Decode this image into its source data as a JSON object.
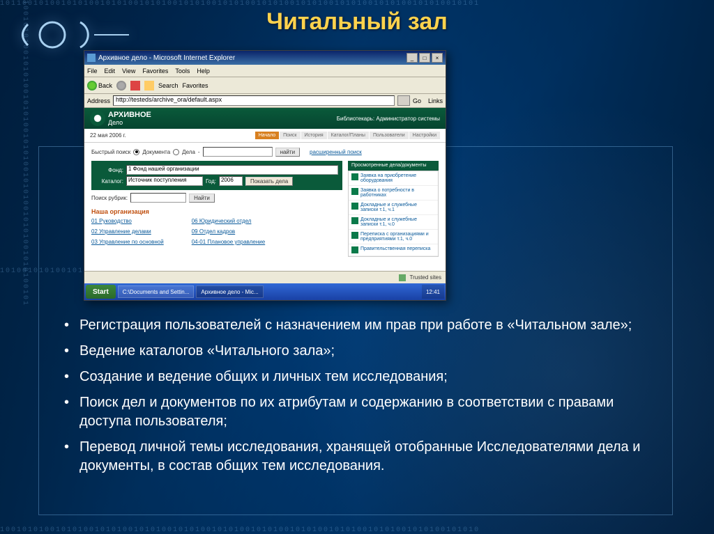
{
  "slide": {
    "title": "Читальный зал"
  },
  "bullets": [
    "Регистрация пользователей с назначением им прав при работе в «Читальном зале»;",
    "Ведение каталогов «Читального зала»;",
    "Создание и ведение общих и личных тем исследования;",
    "Поиск дел и документов по их атрибутам и содержанию в соответствии с правами доступа пользователя;",
    "Перевод личной темы исследования, хранящей отобранные Исследователями дела и документы, в состав общих тем исследования."
  ],
  "browser": {
    "window_title": "Архивное дело - Microsoft Internet Explorer",
    "menu": [
      "File",
      "Edit",
      "View",
      "Favorites",
      "Tools",
      "Help"
    ],
    "toolbar": {
      "back": "Back",
      "search": "Search",
      "favorites": "Favorites"
    },
    "address_label": "Address",
    "address_value": "http://testeds/archive_ora/default.aspx",
    "go": "Go",
    "links": "Links",
    "status": "Trusted sites"
  },
  "app": {
    "brand_top": "АРХИВНОЕ",
    "brand_bottom": "Дело",
    "librarian_label": "Библиотекарь:",
    "librarian_value": "Администратор системы",
    "date": "22 мая 2006 г.",
    "nav": [
      "Начало",
      "Поиск",
      "История",
      "Каталог/Планы",
      "Пользователи",
      "Настройки"
    ],
    "quick_search_label": "Быстрый поиск",
    "radio_doc": "Документа",
    "radio_case": "Дела",
    "search_btn": "найти",
    "adv_search": "расширенный поиск",
    "filter": {
      "fund_label": "Фонд:",
      "fund_value": "1 Фонд нашей организации",
      "catalog_label": "Каталог:",
      "catalog_value": "Источник поступления",
      "year_label": "Год:",
      "year_value": "2006",
      "show_btn": "Показать дела"
    },
    "rubric_label": "Поиск рубрик:",
    "rubric_btn": "Найти",
    "org_heading": "Наша организация",
    "org_links_left": [
      "01 Руководство",
      "02 Управление делами",
      "03 Управление по основной"
    ],
    "org_links_right": [
      "06 Юридический отдел",
      "09 Отдел кадров",
      "04-01 Плановое управление"
    ],
    "viewed_header": "Просмотренные дела/документы",
    "viewed_items": [
      "Заявка на приобретение оборудования",
      "Заявка о потребности в работниках",
      "Докладные и служебные записки т.1, ч.1",
      "Докладные и служебные записки т.1, ч.0",
      "Переписка с организациями и предприятиями т.1, ч.0",
      "Правительственная переписка"
    ]
  },
  "taskbar": {
    "start": "Start",
    "items": [
      "C:\\Documents and Settin...",
      "Архивное дело - Mic..."
    ],
    "time": "12:41"
  }
}
